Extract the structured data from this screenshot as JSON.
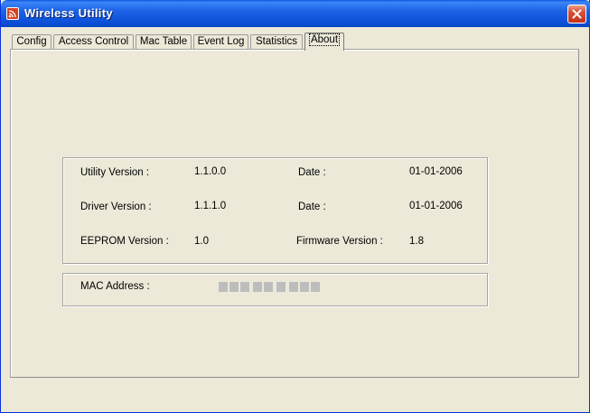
{
  "window": {
    "title": "Wireless Utility"
  },
  "tabs": [
    {
      "label": "Config"
    },
    {
      "label": "Access Control"
    },
    {
      "label": "Mac Table"
    },
    {
      "label": "Event Log"
    },
    {
      "label": "Statistics"
    },
    {
      "label": "About"
    }
  ],
  "about": {
    "utility_version_label": "Utility Version :",
    "utility_version": "1.1.0.0",
    "utility_date_label": "Date :",
    "utility_date": "01-01-2006",
    "driver_version_label": "Driver Version :",
    "driver_version": "1.1.1.0",
    "driver_date_label": "Date :",
    "driver_date": "01-01-2006",
    "eeprom_version_label": "EEPROM Version :",
    "eeprom_version": "1.0",
    "firmware_version_label": "Firmware Version :",
    "firmware_version": "1.8",
    "mac_address_label": "MAC Address :"
  }
}
